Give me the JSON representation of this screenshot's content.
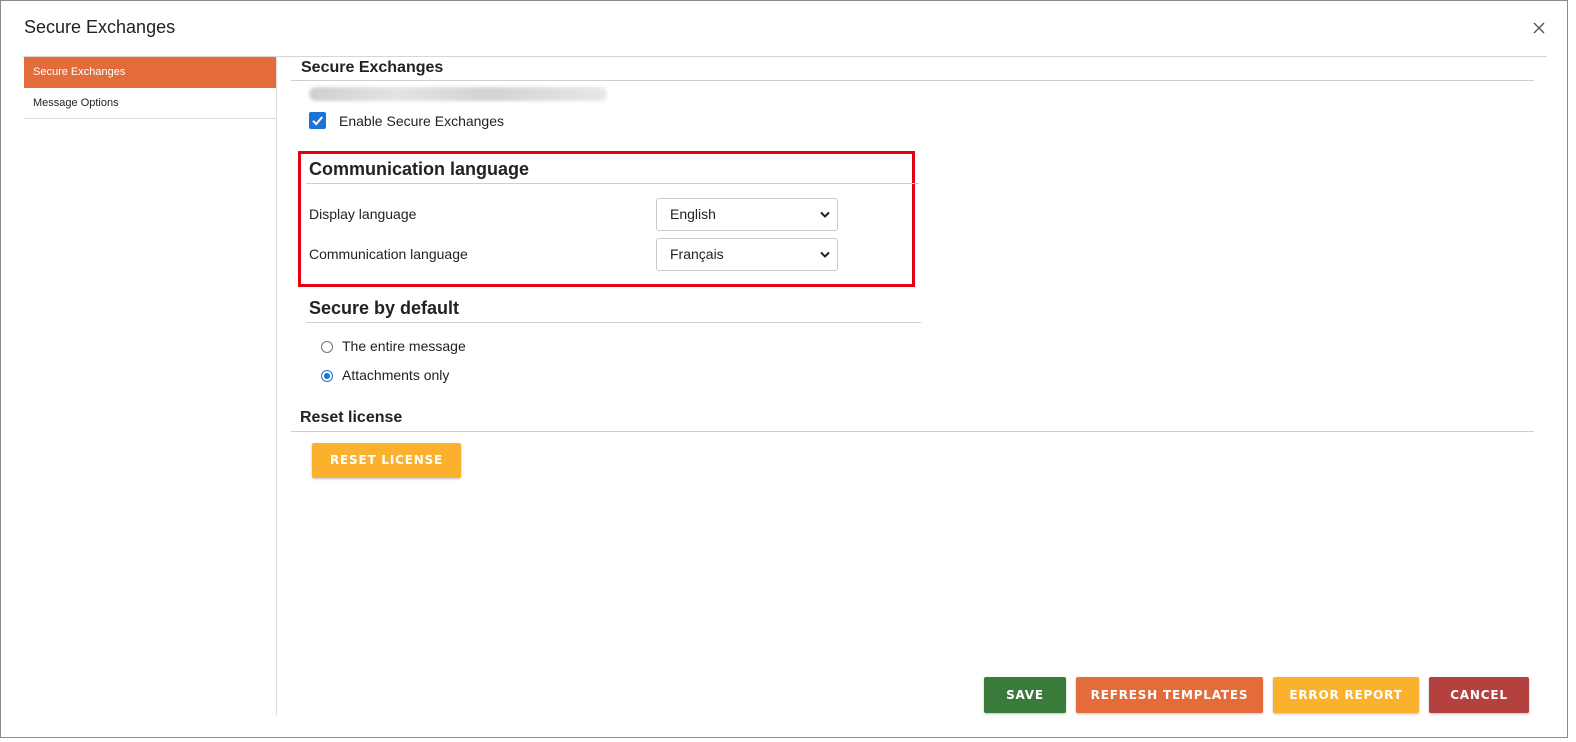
{
  "window": {
    "title": "Secure Exchanges"
  },
  "sidebar": {
    "items": [
      {
        "label": "Secure Exchanges",
        "active": true
      },
      {
        "label": "Message Options",
        "active": false
      }
    ]
  },
  "main": {
    "section_title": "Secure Exchanges",
    "enable_checkbox": {
      "label": "Enable Secure Exchanges",
      "checked": true
    },
    "communication": {
      "heading": "Communication language",
      "display_language": {
        "label": "Display language",
        "value": "English"
      },
      "communication_language": {
        "label": "Communication language",
        "value": "Français"
      }
    },
    "secure_by_default": {
      "heading": "Secure by default",
      "options": [
        {
          "label": "The entire message",
          "selected": false
        },
        {
          "label": "Attachments only",
          "selected": true
        }
      ]
    },
    "reset": {
      "heading": "Reset license",
      "button_label": "RESET LICENSE"
    }
  },
  "footer": {
    "save_label": "SAVE",
    "refresh_label": "REFRESH TEMPLATES",
    "error_label": "ERROR REPORT",
    "cancel_label": "CANCEL"
  },
  "colors": {
    "accent_orange": "#e36c3a",
    "save_green": "#3a7a3a",
    "warning_yellow": "#fbb12d",
    "cancel_red": "#b4403f",
    "highlight_red": "#e3000f",
    "checkbox_blue": "#1a73d6"
  }
}
